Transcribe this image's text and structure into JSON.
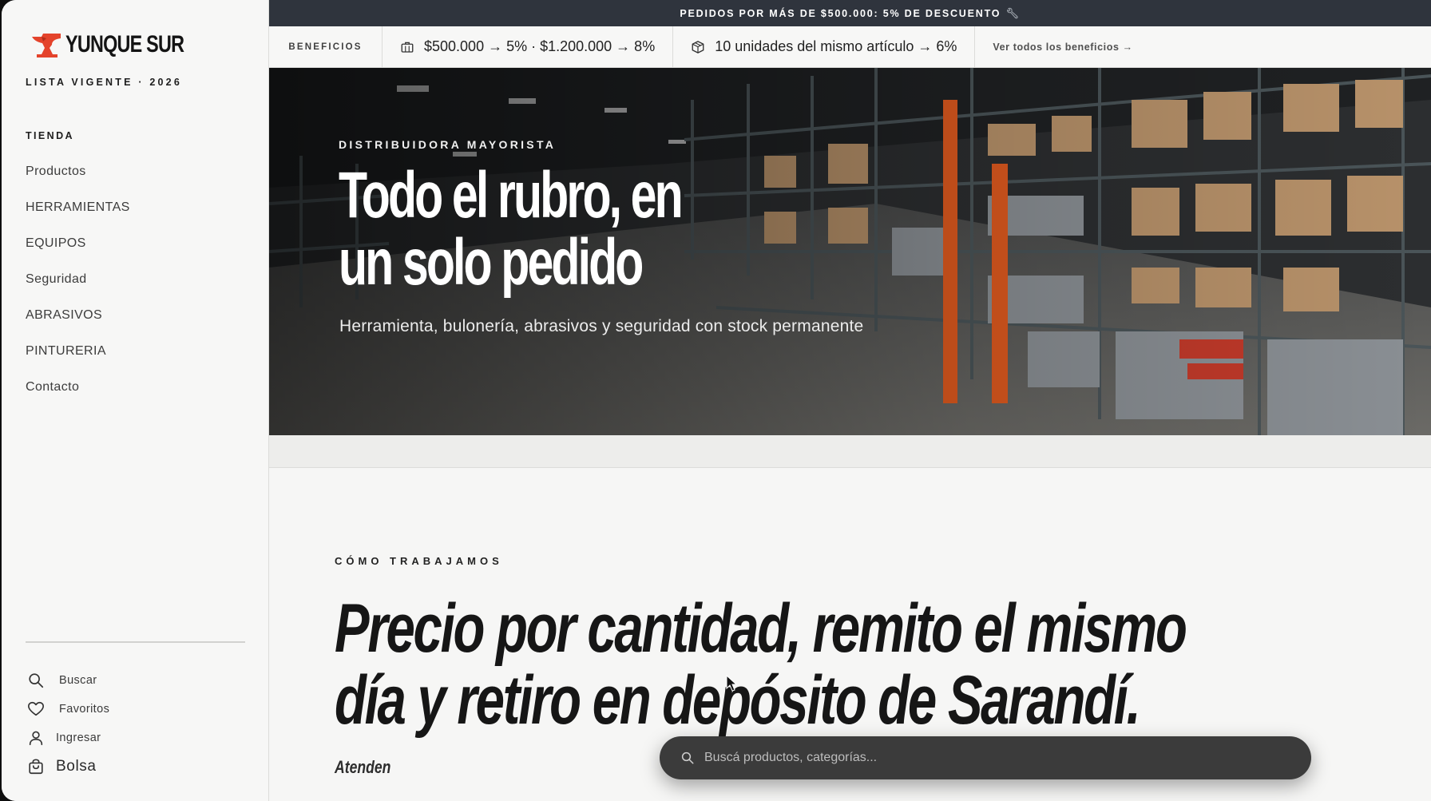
{
  "brand": {
    "name": "YUNQUE SUR",
    "tagline": "LISTA VIGENTE · 2026",
    "accent_color": "#e4432b"
  },
  "sidebar": {
    "section_title": "TIENDA",
    "items": [
      {
        "label": "Productos"
      },
      {
        "label": "HERRAMIENTAS"
      },
      {
        "label": "EQUIPOS"
      },
      {
        "label": "Seguridad"
      },
      {
        "label": "ABRASIVOS"
      },
      {
        "label": "PINTURERIA"
      },
      {
        "label": "Contacto"
      }
    ],
    "actions": {
      "search": {
        "label": "Buscar",
        "icon": "search-icon"
      },
      "favorites": {
        "label": "Favoritos",
        "icon": "heart-icon"
      },
      "login": {
        "label": "Ingresar",
        "icon": "user-icon"
      },
      "bag": {
        "label": "Bolsa",
        "icon": "bag-icon"
      }
    }
  },
  "promo_bar": {
    "text": "PEDIDOS POR MÁS DE $500.000: 5% DE DESCUENTO",
    "icon": "wrench-icon",
    "background": "#2f343d"
  },
  "benefits": {
    "label": "BENEFICIOS",
    "items": [
      {
        "icon": "briefcase-icon",
        "text": "$500.000 → 5% · $1.200.000 → 8%"
      },
      {
        "icon": "box-icon",
        "text": "10 unidades del mismo artículo → 6%"
      }
    ],
    "link": "Ver todos los beneficios →"
  },
  "hero": {
    "eyebrow": "DISTRIBUIDORA MAYORISTA",
    "title_line1": "Todo el rubro, en",
    "title_line2": "un solo pedido",
    "subtitle": "Herramienta, bulonería, abrasivos y seguridad con stock permanente"
  },
  "how": {
    "eyebrow": "CÓMO TRABAJAMOS",
    "title_line1": "Precio por cantidad, remito el mismo",
    "title_line2": "día y retiro en depósito de Sarandí.",
    "subtitle": "Atenden"
  },
  "search": {
    "placeholder": "Buscá productos, categorías..."
  }
}
